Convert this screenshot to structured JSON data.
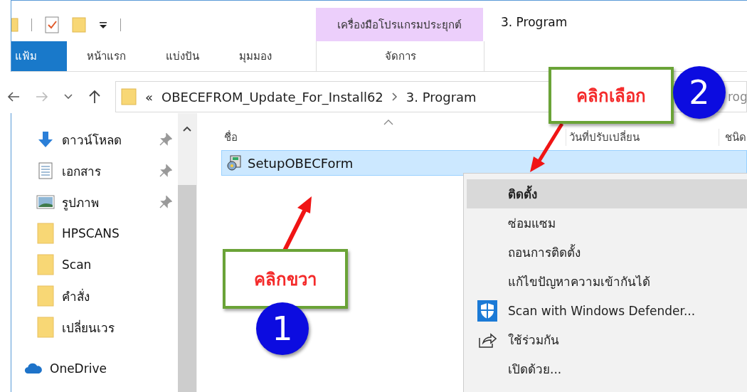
{
  "ribbon": {
    "contextual_group": "เครื่องมือโปรแกรมประยุกต์",
    "title": "3. Program",
    "tabs": [
      {
        "label": "แฟ้ม",
        "kind": "normal",
        "selected": true
      },
      {
        "label": "หน้าแรก",
        "kind": "normal",
        "selected": false
      },
      {
        "label": "แบ่งปัน",
        "kind": "normal",
        "selected": false
      },
      {
        "label": "มุมมอง",
        "kind": "normal",
        "selected": false
      },
      {
        "label": "จัดการ",
        "kind": "contextual",
        "selected": false
      }
    ]
  },
  "address_bar": {
    "overflow": "«",
    "segments": [
      "OBECEFROM_Update_For_Install62",
      "3. Program"
    ]
  },
  "search": {
    "placeholder": "rog"
  },
  "sidebar": {
    "items": [
      {
        "label": "ดาวน์โหลด",
        "kind": "download",
        "pinned": true
      },
      {
        "label": "เอกสาร",
        "kind": "document",
        "pinned": true
      },
      {
        "label": "รูปภาพ",
        "kind": "picture",
        "pinned": true
      },
      {
        "label": "HPSCANS",
        "kind": "folder",
        "pinned": false
      },
      {
        "label": "Scan",
        "kind": "folder",
        "pinned": false
      },
      {
        "label": "คำสั่ง",
        "kind": "folder",
        "pinned": false
      },
      {
        "label": "เปลี่ยนเวร",
        "kind": "folder",
        "pinned": false
      },
      {
        "label": "OneDrive",
        "kind": "cloud",
        "pinned": false
      }
    ]
  },
  "file_list": {
    "columns": [
      "ชื่อ",
      "วันที่ปรับเปลี่ยน",
      "ชนิด"
    ],
    "files": [
      {
        "name": "SetupOBECForm",
        "selected": true
      }
    ]
  },
  "context_menu": {
    "items": [
      {
        "label": "ติดตั้ง",
        "kind": "default",
        "selected": true
      },
      {
        "label": "ซ่อมแซม",
        "kind": "plain",
        "selected": false
      },
      {
        "label": "ถอนการติดตั้ง",
        "kind": "plain",
        "selected": false
      },
      {
        "label": "แก้ไขปัญหาความเข้ากันได้",
        "kind": "plain",
        "selected": false
      },
      {
        "label": "Scan with Windows Defender...",
        "kind": "defender",
        "selected": false
      },
      {
        "label": "ใช้ร่วมกัน",
        "kind": "share",
        "selected": false
      },
      {
        "label": "เปิดด้วย...",
        "kind": "plain",
        "selected": false
      }
    ]
  },
  "annotations": [
    {
      "label": "คลิกขวา",
      "number": "1"
    },
    {
      "label": "คลิกเลือก",
      "number": "2"
    }
  ]
}
